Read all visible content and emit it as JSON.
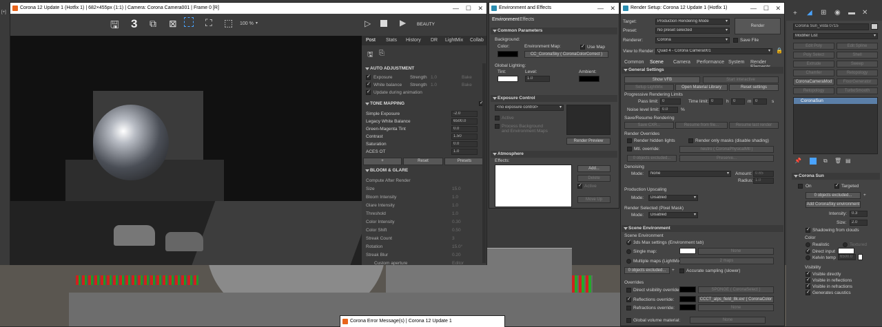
{
  "viewport": {
    "corner_label": "[+]"
  },
  "vfb": {
    "title": "Corona 12 Update 1 (Hotfix 1) | 682×455px (1:1) | Camera: Corona Camera001 | Frame 0 [R]",
    "counter": "3",
    "zoom": "100 %",
    "beauty": "BEAUTY",
    "tabs": [
      "Post",
      "Stats",
      "History",
      "DR",
      "LightMix",
      "Collab"
    ],
    "auto_adjust": {
      "title": "AUTO ADJUSTMENT",
      "rows": [
        {
          "label": "Exposure",
          "strength": "Strength",
          "val": "1.0",
          "bake": "Bake"
        },
        {
          "label": "White balance",
          "strength": "Strength",
          "val": "1.0",
          "bake": "Bake"
        }
      ],
      "update": "Update during animation"
    },
    "tone": {
      "title": "TONE MAPPING",
      "rows": [
        {
          "label": "Simple Exposure",
          "val": "-2.0"
        },
        {
          "label": "Legacy White Balance",
          "val": "6500.0"
        },
        {
          "label": "Green-Magenta Tint",
          "val": "0.0"
        },
        {
          "label": "Contrast",
          "val": "1.50"
        },
        {
          "label": "Saturation",
          "val": "0.0"
        },
        {
          "label": "ACES OT",
          "val": "1.0"
        }
      ],
      "plus": "+",
      "reset": "Reset",
      "presets": "Presets"
    },
    "bloom": {
      "title": "BLOOM & GLARE",
      "rows": [
        {
          "label": "Compute After Render",
          "val": ""
        },
        {
          "label": "Size",
          "val": "15.0"
        },
        {
          "label": "Bloom Intensity",
          "val": "1.0"
        },
        {
          "label": "Glare Intensity",
          "val": "1.0"
        },
        {
          "label": "Threshold",
          "val": "1.0"
        },
        {
          "label": "Color Intensity",
          "val": "0.30"
        },
        {
          "label": "Color Shift",
          "val": "0.50"
        },
        {
          "label": "Streak Count",
          "val": "3"
        },
        {
          "label": "Rotation",
          "val": "15.0°"
        },
        {
          "label": "Streak Blur",
          "val": "0.20"
        }
      ],
      "custom": "Custom aperture",
      "editor": "Editor"
    }
  },
  "env": {
    "title": "Environment and Effects",
    "tabs": [
      "Environment",
      "Effects"
    ],
    "common": "Common Parameters",
    "background": "Background:",
    "color": "Color:",
    "env_map": "Environment Map:",
    "use_map": "Use Map",
    "map_name": "CC_CoronaSky ( CoronaColorCorrect )",
    "global_lighting": "Global Lighting:",
    "tint": "Tint:",
    "level": "Level:",
    "level_val": "1.0",
    "ambient": "Ambient:",
    "exposure": "Exposure Control",
    "exposure_sel": "<no exposure control>",
    "active": "Active",
    "process": "Process Background\nand Environment Maps",
    "render_preview": "Render Preview",
    "atmosphere": "Atmosphere",
    "effects": "Effects:",
    "add": "Add...",
    "delete": "Delete",
    "active2": "Active",
    "move_up": "Move Up"
  },
  "setup": {
    "title": "Render Setup: Corona 12 Update 1 (Hotfix 1)",
    "target_lbl": "Target:",
    "target": "Production Rendering Mode",
    "preset_lbl": "Preset:",
    "preset": "No preset selected",
    "renderer_lbl": "Renderer:",
    "renderer": "Corona",
    "save_file": "Save File",
    "render": "Render",
    "view_lbl": "View to Render:",
    "view": "Quad 4 - Corona Camera001",
    "tabs": [
      "Common",
      "Scene",
      "Camera",
      "Performance",
      "System",
      "Render Elements"
    ],
    "general": "General Settings",
    "show_vfb": "Show VFB",
    "start_interactive": "Start interactive",
    "setup_lightmix": "Setup LightMix",
    "open_mat": "Open Material Library",
    "reset_settings": "Reset settings",
    "prog_limits": "Progressive Rendering Limits",
    "pass_limit": "Pass limit:",
    "pass_val": "0",
    "time_limit": "Time limit:",
    "t0": "0",
    "h": "h",
    "t1": "0",
    "m": "m",
    "t2": "0",
    "s": "s",
    "noise": "Noise level limit:",
    "noise_val": "0.0",
    "pct": "%",
    "save_resume": "Save/Resume Rendering",
    "save_cxr": "Save CXR...",
    "resume_file": "Resume from file...",
    "resume_last": "Resume last render",
    "overrides": "Render Overrides",
    "hidden_lights": "Render hidden lights",
    "only_masks": "Render only masks (disable shading)",
    "mtl_override": "Mtl. override:",
    "mtl_val": "neutro ( CoronaPhysicalMtl )",
    "objects_excluded": "0 objects excluded...",
    "preserve": "Preserve...",
    "denoising": "Denoising",
    "mode": "Mode:",
    "none": "None",
    "amount": "Amount:",
    "amount_val": "0.65",
    "radius": "Radius:",
    "radius_val": "1.0",
    "upscaling": "Production Upscaling",
    "disabled": "Disabled",
    "pixel_mask": "Render Selected (Pixel Mask)",
    "scene_env": "Scene Environment",
    "scene_env2": "Scene Environment",
    "max_settings": "3ds Max settings (Environment tab)",
    "single_map": "Single map:",
    "none2": "None",
    "multiple_maps": "Multiple maps (LightMix):",
    "two_maps": "2 maps",
    "obj_excl": "0 objects excluded...",
    "accurate": "Accurate sampling (slower)",
    "overrides2": "Overrides",
    "direct_vis": "Direct visibility override:",
    "direct_map": "SPONGE ( CoronaSelect )",
    "refl": "Reflections override:",
    "refl_map": "CCCT_alps_field_8k.exr ( CoronaColor",
    "refr": "Refractions override:",
    "refr_map": "None",
    "global_vol": "Global volume material:",
    "global_vol_map": "None"
  },
  "cmd": {
    "object_name": "Corona Sun_vista 0715",
    "modifier_list": "Modifier List",
    "buttons": [
      "Edit Poly",
      "Edit Spline",
      "Poly Select",
      "Shell",
      "Extrude",
      "Sweep",
      "Chamfer",
      "Retopology",
      "CoronaCameraMod",
      "FloorGenerator",
      "Retopology",
      "TurboSmooth"
    ],
    "stack_item": "CoronaSun",
    "rollout": "Corona Sun",
    "on": "On",
    "targeted": "Targeted",
    "obj_excl": "0 objects excluded...",
    "add_sky": "Add CoronaSky environment",
    "intensity": "Intensity:",
    "intensity_val": "0.3",
    "size": "Size:",
    "size_val": "2.0",
    "shadowing": "Shadowing from clouds",
    "color": "Color",
    "realistic": "Realistic",
    "textured": "Textured",
    "direct_input": "Direct input",
    "kelvin": "Kelvin temp",
    "kelvin_val": "6500.0",
    "visibility": "Visibility",
    "vis_items": [
      "Visible directly",
      "Visible in reflections",
      "Visible in refractions",
      "Generates caustics"
    ]
  },
  "error": {
    "title": "Corona Error Message(s)",
    "title2": "Corona 12 Update 1"
  }
}
